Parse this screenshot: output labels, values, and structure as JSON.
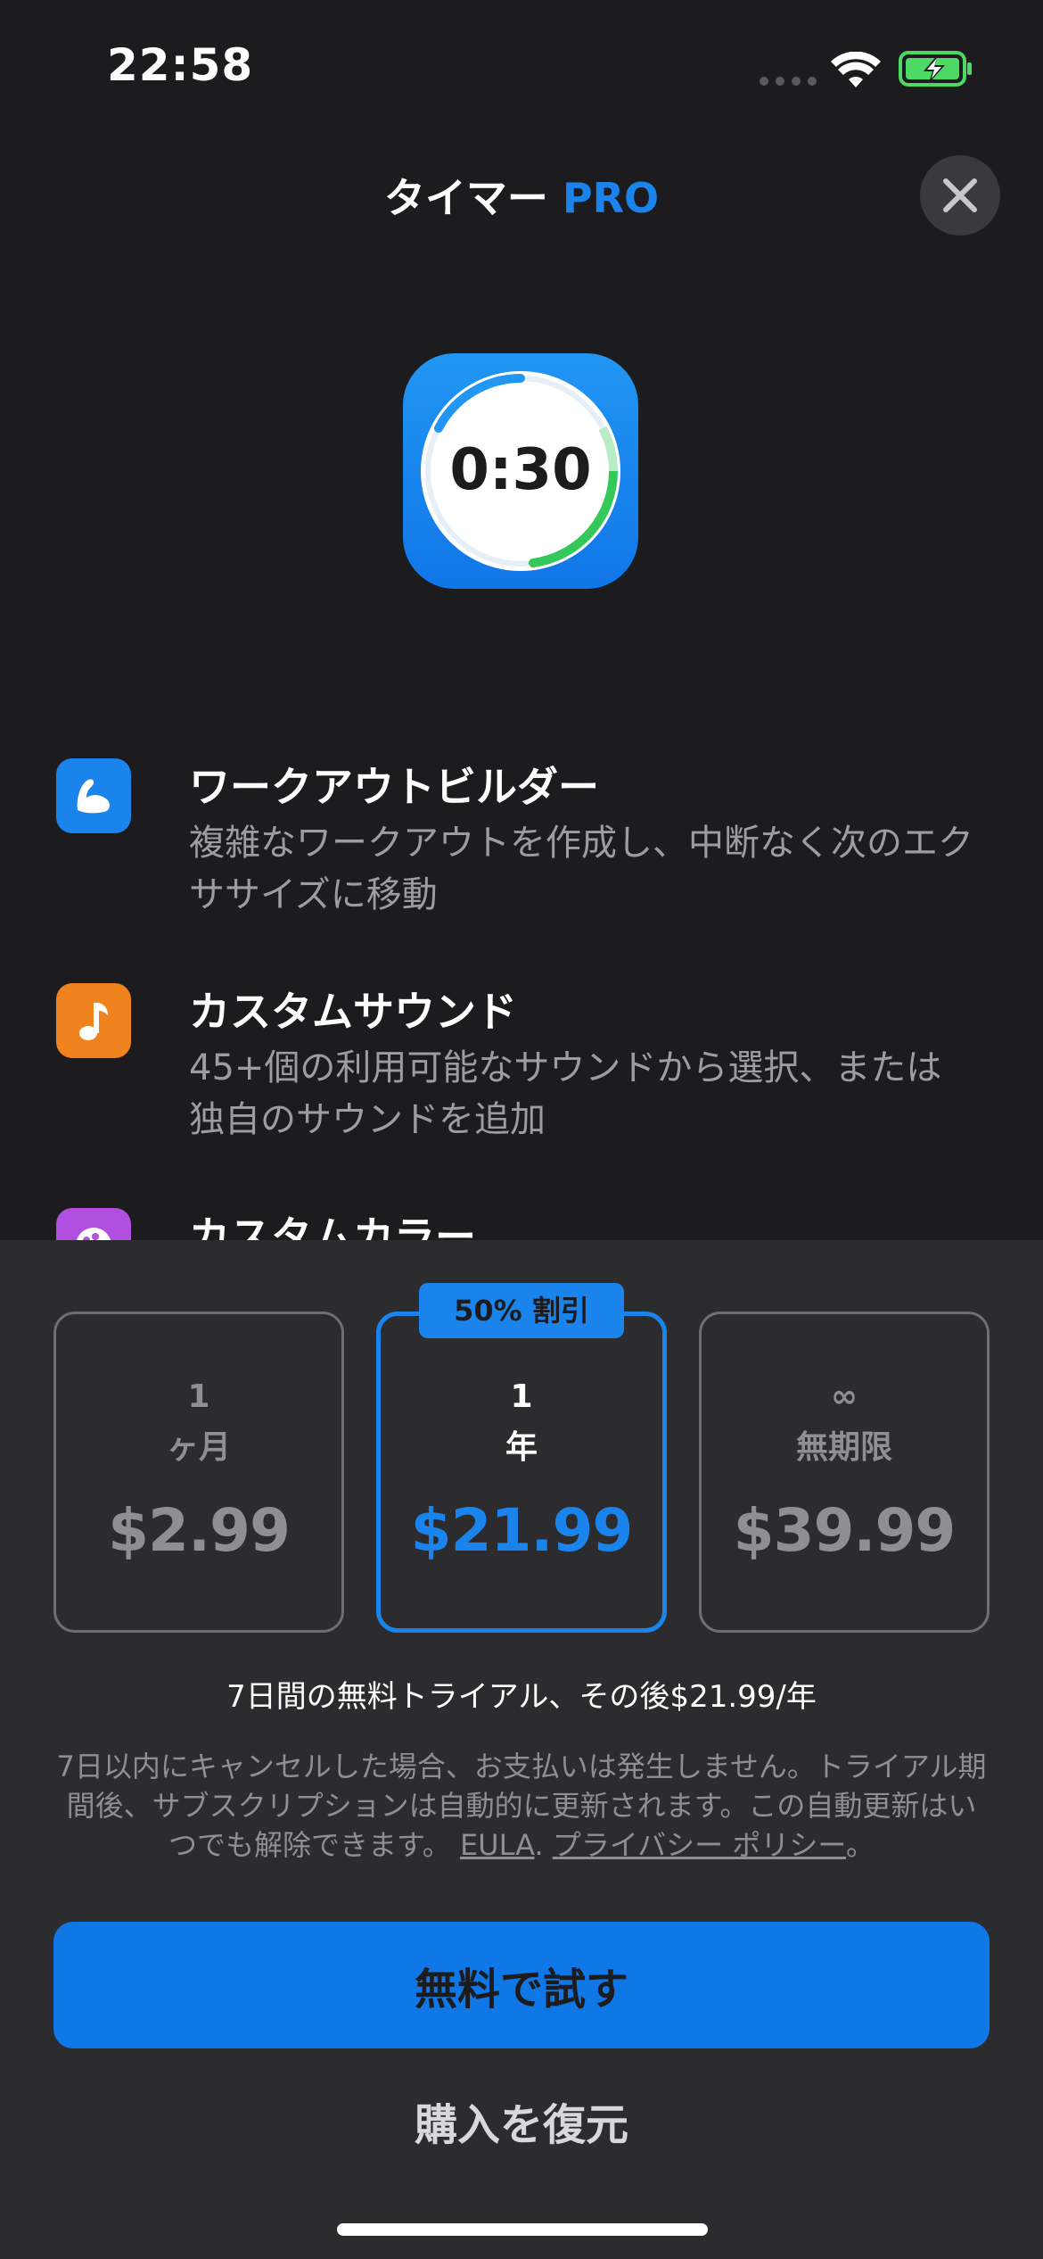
{
  "status_bar": {
    "time": "22:58"
  },
  "header": {
    "title": "タイマー",
    "title_accent": "PRO"
  },
  "app_icon": {
    "timer_text": "0:30"
  },
  "features": [
    {
      "icon": "flexed-arm-icon",
      "icon_color": "#1a84ec",
      "title": "ワークアウトビルダー",
      "description": "複雑なワークアウトを作成し、中断なく次のエクササイズに移動"
    },
    {
      "icon": "music-note-icon",
      "icon_color": "#f0831e",
      "title": "カスタムサウンド",
      "description": "45+個の利用可能なサウンドから選択、または独自のサウンドを追加"
    },
    {
      "icon": "palette-icon",
      "icon_color": "#b14fe0",
      "title": "カスタムカラー",
      "description": ""
    }
  ],
  "plans": [
    {
      "qty": "1",
      "unit": "ヶ月",
      "price": "$2.99",
      "selected": false
    },
    {
      "qty": "1",
      "unit": "年",
      "price": "$21.99",
      "selected": true,
      "badge": "50% 割引"
    },
    {
      "qty": "∞",
      "unit": "無期限",
      "price": "$39.99",
      "selected": false
    }
  ],
  "trial_text": "7日間の無料トライアル、その後$21.99/年",
  "legal": {
    "text": "7日以内にキャンセルした場合、お支払いは発生しません。トライアル期間後、サブスクリプションは自動的に更新されます。この自動更新はいつでも解除できます。",
    "eula_link": "EULA",
    "separator": ".",
    "privacy_link": "プライバシー ポリシー",
    "end": "。"
  },
  "cta_label": "無料で試す",
  "restore_label": "購入を復元",
  "colors": {
    "accent": "#1a84ec",
    "background": "#1c1c1e",
    "panel": "#2c2c2e"
  }
}
